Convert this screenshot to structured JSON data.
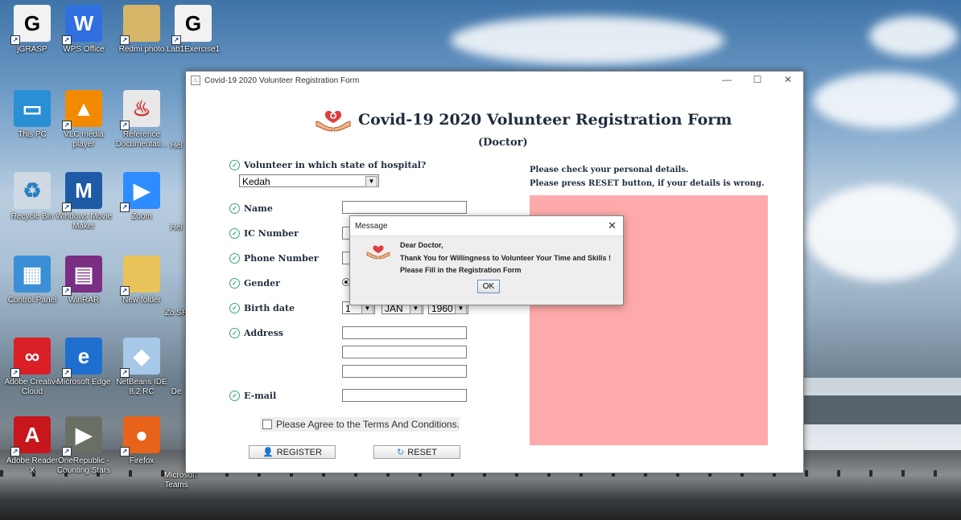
{
  "desktop": {
    "icons": [
      {
        "label": "jGRASP",
        "glyph": "G",
        "color": "#f2f2f2",
        "fg": "#000"
      },
      {
        "label": "WPS Office",
        "glyph": "W",
        "color": "#2f6fe0",
        "fg": "#fff"
      },
      {
        "label": "Redmi photo",
        "glyph": "",
        "color": "#d7b66a",
        "fg": "#fff"
      },
      {
        "label": "Lab1Exercise1",
        "glyph": "G",
        "color": "#f2f2f2",
        "fg": "#000"
      },
      {
        "label": "This PC",
        "glyph": "▭",
        "color": "#2a8fd4",
        "fg": "#fff"
      },
      {
        "label": "VLC media player",
        "glyph": "▲",
        "color": "#f18a00",
        "fg": "#fff"
      },
      {
        "label": "Reference Documentati...",
        "glyph": "♨",
        "color": "#e8e8e8",
        "fg": "#c33"
      },
      {
        "label": "Recycle Bin",
        "glyph": "♻",
        "color": "#cfd9e4",
        "fg": "#2a7fc0"
      },
      {
        "label": "Windows Movie Maker",
        "glyph": "M",
        "color": "#1f5aa6",
        "fg": "#fff"
      },
      {
        "label": "Zoom",
        "glyph": "▶",
        "color": "#2d8cff",
        "fg": "#fff"
      },
      {
        "label": "Control Panel",
        "glyph": "▦",
        "color": "#3a8fd6",
        "fg": "#fff"
      },
      {
        "label": "WinRAR",
        "glyph": "▤",
        "color": "#7a2f84",
        "fg": "#fff"
      },
      {
        "label": "New folder",
        "glyph": "",
        "color": "#e7c35a",
        "fg": "#fff"
      },
      {
        "label": "Adobe Creative Cloud",
        "glyph": "∞",
        "color": "#da1f26",
        "fg": "#fff"
      },
      {
        "label": "Microsoft Edge",
        "glyph": "e",
        "color": "#1e6fd0",
        "fg": "#fff"
      },
      {
        "label": "NetBeans IDE 8.2 RC",
        "glyph": "◆",
        "color": "#a8c8e8",
        "fg": "#fff"
      },
      {
        "label": "Adobe Reader X",
        "glyph": "A",
        "color": "#c8161d",
        "fg": "#fff"
      },
      {
        "label": "OneRepublic - Counting Stars",
        "glyph": "▶",
        "color": "#6a6f66",
        "fg": "#fff"
      },
      {
        "label": "Firefox",
        "glyph": "●",
        "color": "#e8631a",
        "fg": "#fff"
      }
    ],
    "partial_labels": [
      "Hel",
      "Hel",
      "Hel",
      "Zo SR",
      "De",
      "Microsoft Teams"
    ]
  },
  "window": {
    "title": "Covid-19 2020 Volunteer Registration Form",
    "controls": {
      "minimize": "—",
      "maximize": "☐",
      "close": "✕"
    }
  },
  "form": {
    "heading": "Covid-19 2020 Volunteer Registration Form",
    "subheading": "(Doctor)",
    "state_label": "Volunteer in which state of hospital?",
    "state_value": "Kedah",
    "labels": {
      "name": "Name",
      "ic": "IC Number",
      "phone": "Phone Number",
      "gender": "Gender",
      "birth": "Birth date",
      "address": "Address",
      "email": "E-mail"
    },
    "birth": {
      "day": "1",
      "month": "JAN",
      "year": "1960"
    },
    "agree_text": "Please Agree to the Terms And Conditions.",
    "register_label": "REGISTER",
    "reset_label": "RESET"
  },
  "instructions": {
    "line1": "Please check your personal details.",
    "line2": "Please press RESET button, if your details is wrong."
  },
  "colors": {
    "panel": "#ffaaaa",
    "accent_check": "#3aa37a"
  },
  "dialog": {
    "title": "Message",
    "line1": "Dear Doctor,",
    "line2": "Thank You for Willingness to Volunteer Your Time and Skills !",
    "line3": "Please Fill in the Registration Form",
    "ok_label": "OK"
  }
}
